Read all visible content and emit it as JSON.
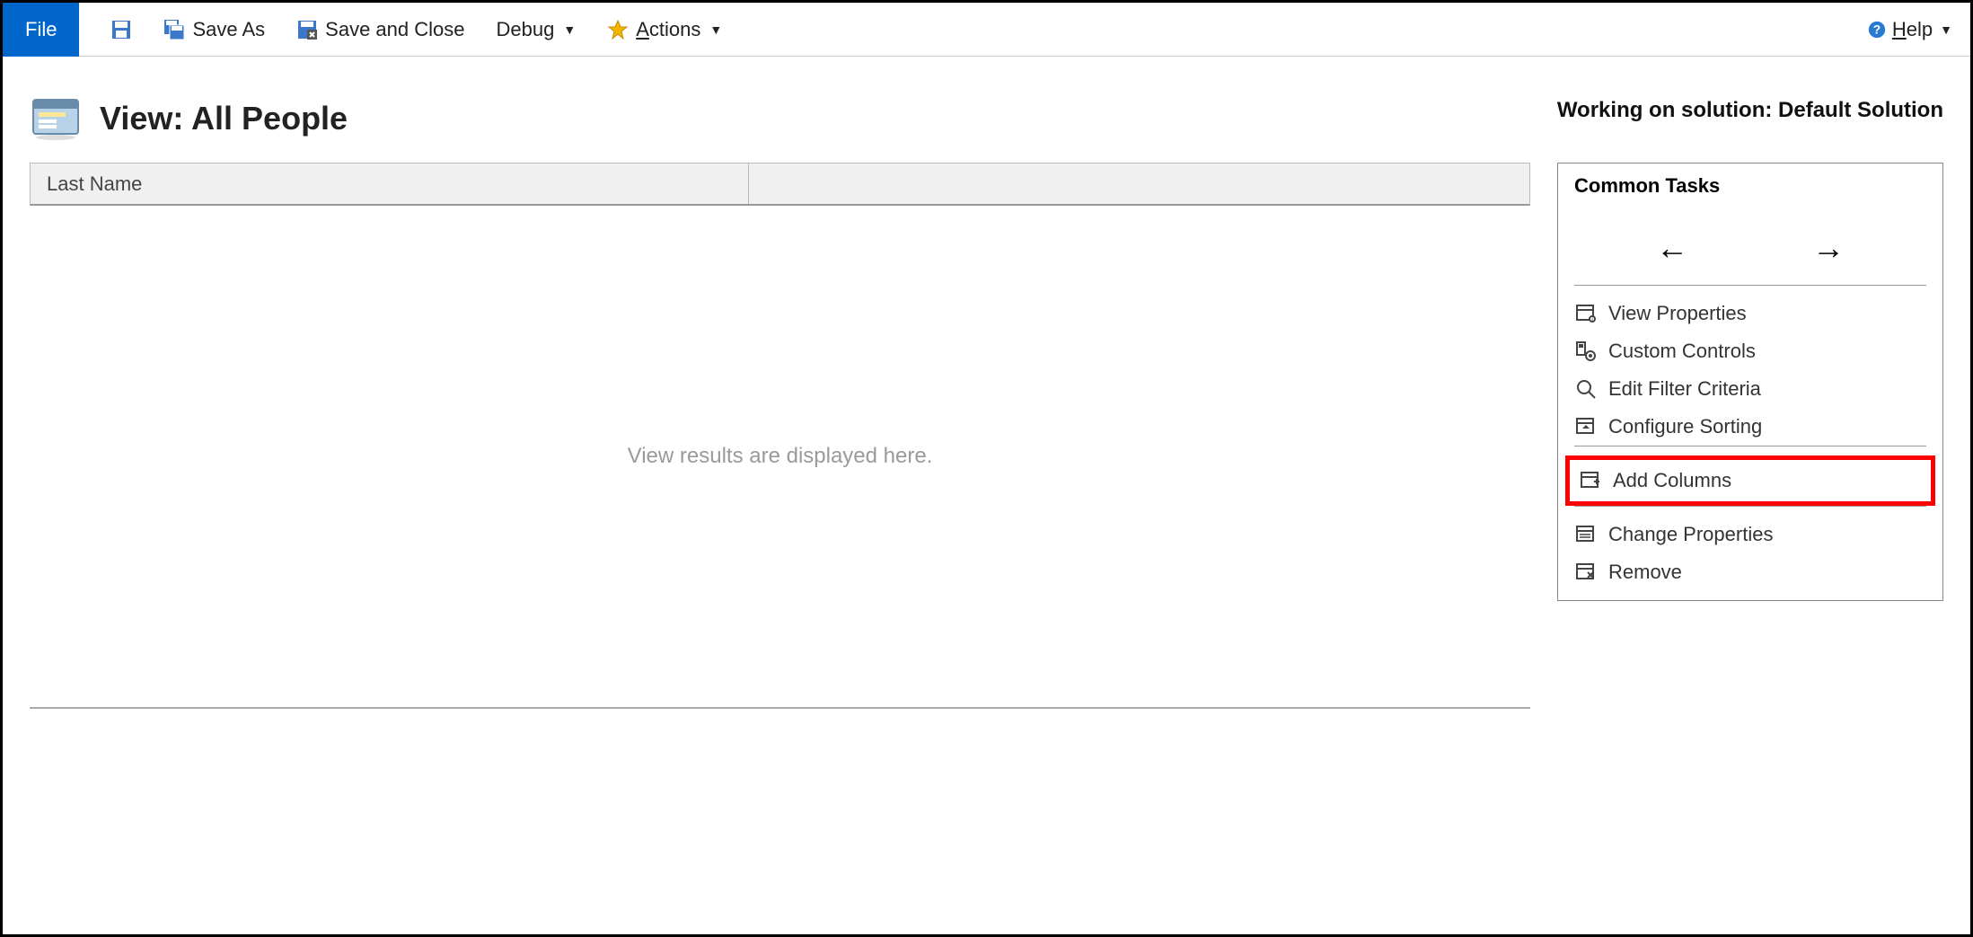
{
  "toolbar": {
    "file": "File",
    "save_as": "Save As",
    "save_and_close": "Save and Close",
    "debug": "Debug",
    "actions": "Actions",
    "help": "Help"
  },
  "header": {
    "title": "View: All People",
    "solution": "Working on solution: Default Solution"
  },
  "grid": {
    "columns": [
      "Last Name"
    ],
    "placeholder": "View results are displayed here."
  },
  "tasks": {
    "title": "Common Tasks",
    "group1": [
      {
        "label": "View Properties",
        "icon": "view-properties-icon"
      },
      {
        "label": "Custom Controls",
        "icon": "custom-controls-icon"
      },
      {
        "label": "Edit Filter Criteria",
        "icon": "filter-icon"
      },
      {
        "label": "Configure Sorting",
        "icon": "sort-icon"
      }
    ],
    "add_columns": {
      "label": "Add Columns",
      "icon": "add-columns-icon"
    },
    "group2": [
      {
        "label": "Change Properties",
        "icon": "change-properties-icon"
      },
      {
        "label": "Remove",
        "icon": "remove-icon"
      }
    ]
  },
  "highlight": "add_columns"
}
